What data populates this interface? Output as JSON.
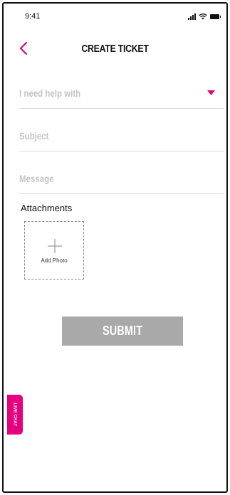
{
  "status_bar": {
    "time": "9:41",
    "icons": [
      "signal-icon",
      "wifi-icon",
      "battery-icon"
    ]
  },
  "header": {
    "back_icon": "chevron-left-icon",
    "title": "CREATE TICKET"
  },
  "form": {
    "help_with_placeholder": "I need help with",
    "subject_placeholder": "Subject",
    "message_placeholder": "Message",
    "attachments_label": "Attachments",
    "add_photo_label": "Add Photo",
    "submit_label": "SUBMIT"
  },
  "live_chat": {
    "label": "LIVE CHAT"
  },
  "colors": {
    "accent": "#e6007e",
    "placeholder": "#c4c4c4",
    "submit_bg": "#a9a9a9",
    "divider": "#dcdcdc"
  }
}
